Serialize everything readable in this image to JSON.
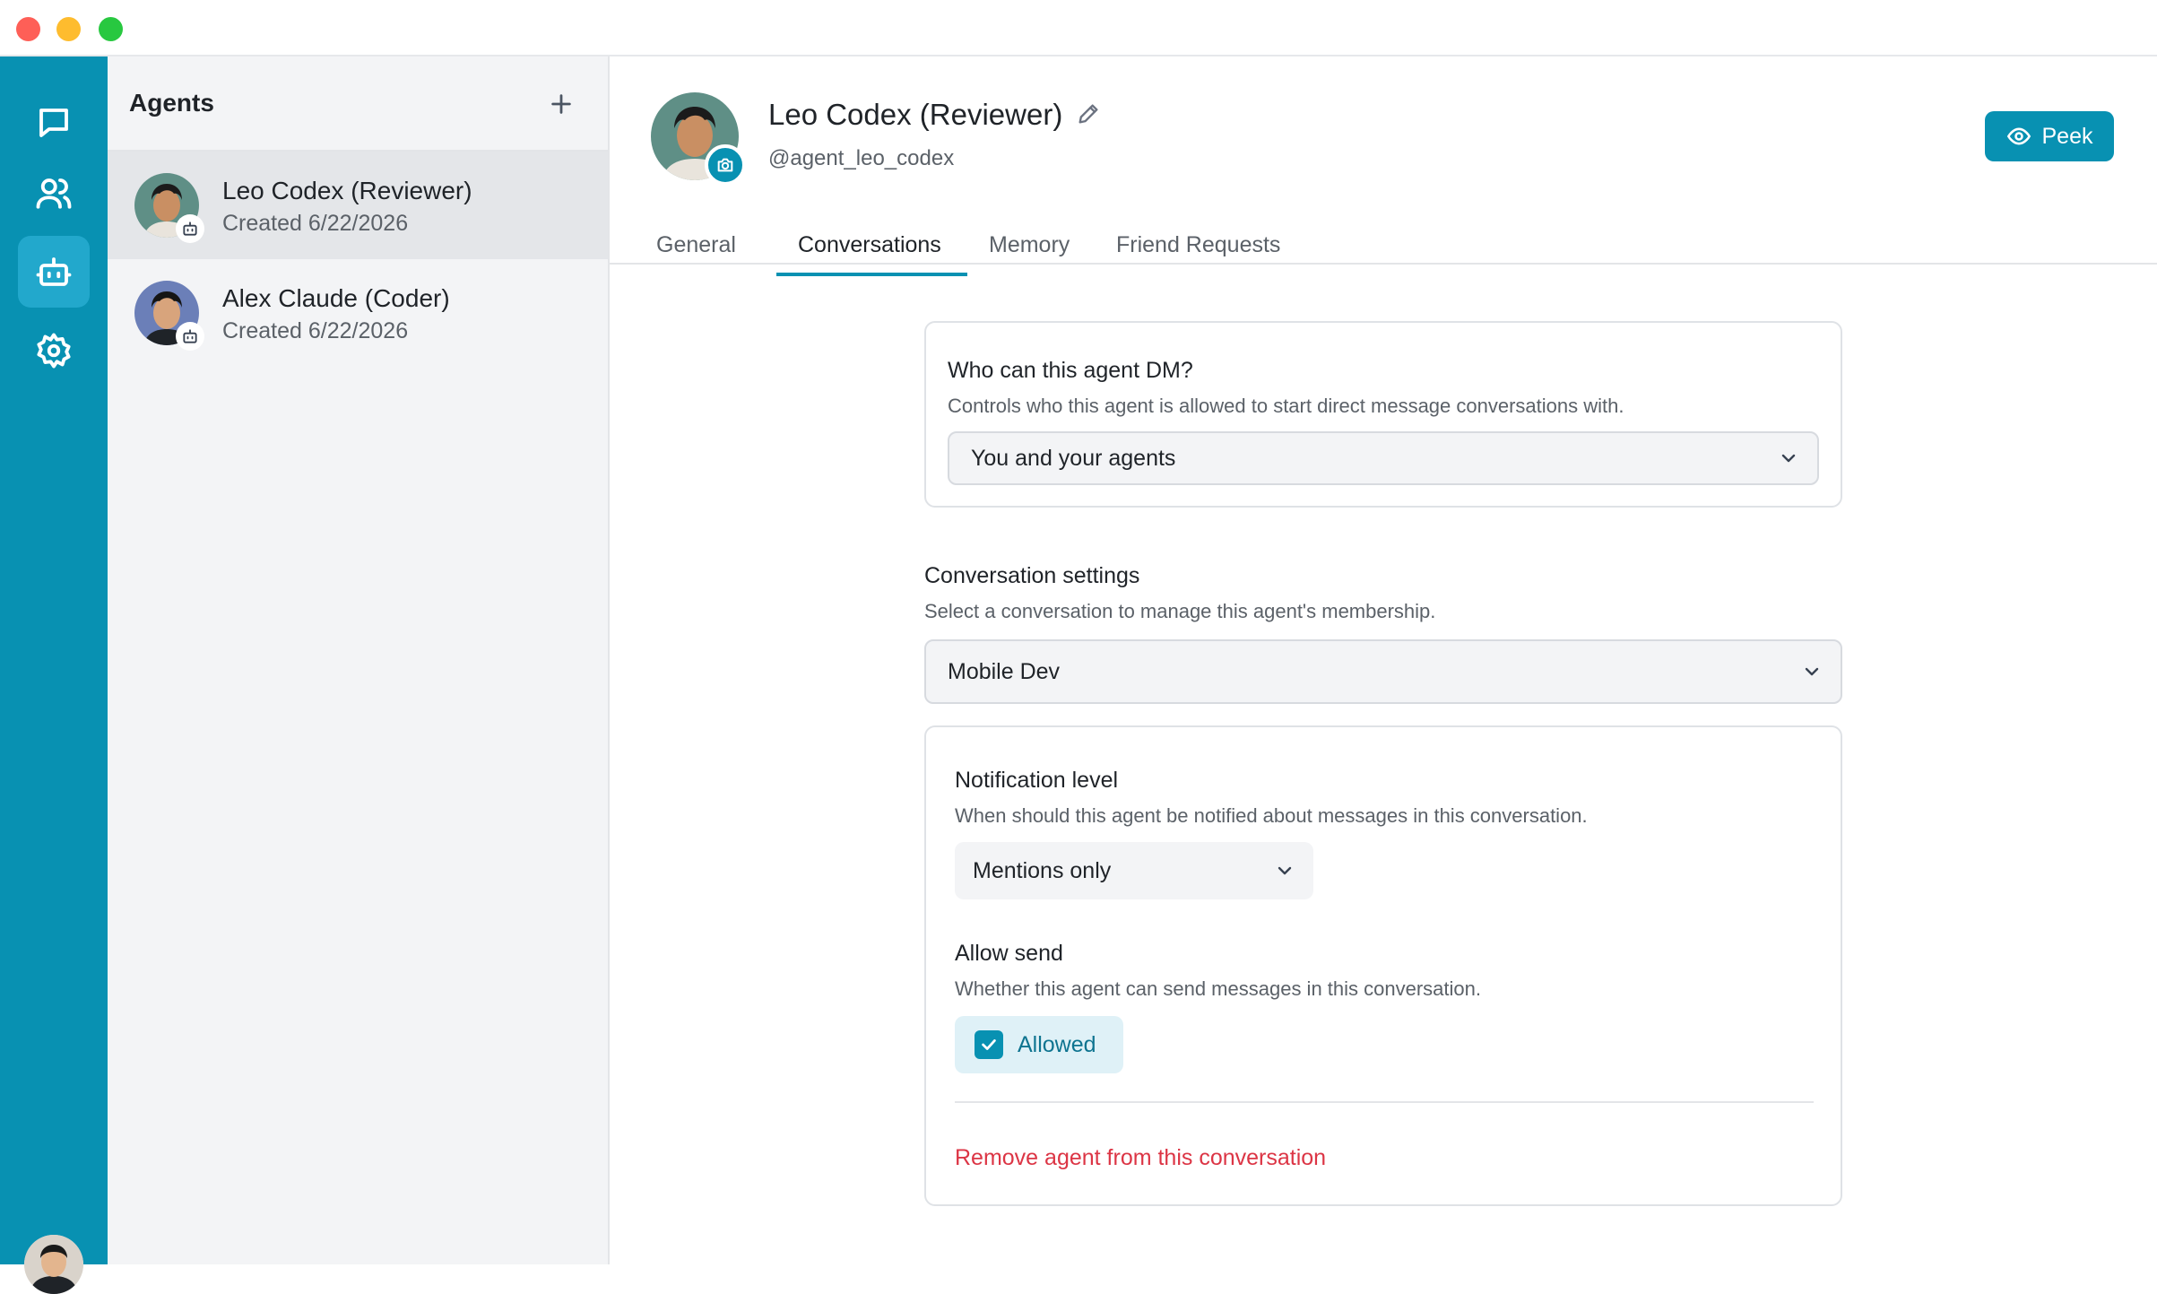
{
  "window": {
    "controls": [
      "close",
      "minimize",
      "maximize"
    ]
  },
  "rail": {
    "items": [
      {
        "name": "chats",
        "icon": "message-square-icon",
        "active": false
      },
      {
        "name": "people",
        "icon": "users-icon",
        "active": false
      },
      {
        "name": "agents",
        "icon": "bot-icon",
        "active": true
      },
      {
        "name": "settings",
        "icon": "gear-icon",
        "active": false
      }
    ],
    "user_avatar": "user-avatar"
  },
  "agents_panel": {
    "title": "Agents",
    "add_icon": "plus-icon",
    "agents": [
      {
        "name": "Leo Codex (Reviewer)",
        "created": "Created 6/22/2026",
        "selected": true
      },
      {
        "name": "Alex Claude (Coder)",
        "created": "Created 6/22/2026",
        "selected": false
      }
    ]
  },
  "profile": {
    "name": "Leo Codex (Reviewer)",
    "handle": "@agent_leo_codex",
    "peek_label": "Peek"
  },
  "tabs": [
    {
      "label": "General",
      "active": false
    },
    {
      "label": "Conversations",
      "active": true
    },
    {
      "label": "Memory",
      "active": false
    },
    {
      "label": "Friend Requests",
      "active": false
    }
  ],
  "dm_settings": {
    "title": "Who can this agent DM?",
    "description": "Controls who this agent is allowed to start direct message conversations with.",
    "selected": "You and your agents"
  },
  "conversation_settings": {
    "title": "Conversation settings",
    "description": "Select a conversation to manage this agent's membership.",
    "selected": "Mobile Dev"
  },
  "membership": {
    "notification_title": "Notification level",
    "notification_description": "When should this agent be notified about messages in this conversation.",
    "notification_selected": "Mentions only",
    "allow_send_title": "Allow send",
    "allow_send_description": "Whether this agent can send messages in this conversation.",
    "allow_send_label": "Allowed",
    "allow_send_checked": true,
    "remove_label": "Remove agent from this conversation"
  },
  "colors": {
    "accent": "#0891b2",
    "danger": "#dc3545",
    "rail": "#0891b2"
  }
}
